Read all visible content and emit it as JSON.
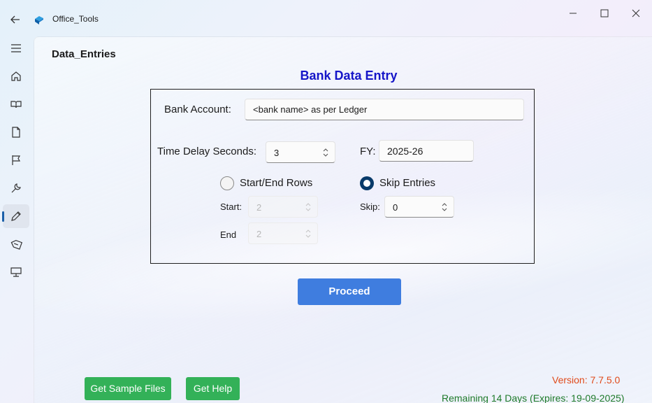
{
  "window": {
    "title": "Office_Tools",
    "icons": [
      "back-arrow-icon",
      "app-logo-icon",
      "minimize-icon",
      "maximize-icon",
      "close-icon"
    ]
  },
  "sidebar": {
    "items": [
      {
        "name": "menu",
        "icon": "hamburger-icon"
      },
      {
        "name": "home",
        "icon": "home-icon"
      },
      {
        "name": "book",
        "icon": "book-icon"
      },
      {
        "name": "document",
        "icon": "document-icon"
      },
      {
        "name": "flag",
        "icon": "flag-icon"
      },
      {
        "name": "tools",
        "icon": "wrench-icon"
      },
      {
        "name": "edit",
        "icon": "pencil-icon",
        "active": true
      },
      {
        "name": "tag",
        "icon": "eraser-icon"
      },
      {
        "name": "desktop",
        "icon": "desktop-icon"
      }
    ]
  },
  "page": {
    "title": "Data_Entries",
    "heading": "Bank Data Entry",
    "heading_color": "#1515c8"
  },
  "form": {
    "bank_account_label": "Bank Account:",
    "bank_account_value": "<bank name> as per Ledger",
    "time_delay_label": "Time Delay Seconds:",
    "time_delay_value": "3",
    "fy_label": "FY:",
    "fy_value": "2025-26",
    "option_start_end": "Start/End Rows",
    "option_skip": "Skip Entries",
    "selected_option": "Skip Entries",
    "start_label": "Start:",
    "start_value": "2",
    "end_label": "End",
    "end_value": "2",
    "skip_label": "Skip:",
    "skip_value": "0"
  },
  "actions": {
    "proceed": "Proceed",
    "get_sample_files": "Get Sample Files",
    "get_help": "Get Help"
  },
  "footer": {
    "version": "Version: 7.7.5.0",
    "remaining": "Remaining 14 Days (Expires: 19-09-2025)"
  },
  "colors": {
    "accent": "#3f7ddf",
    "green": "#33b158",
    "version": "#e04a1a",
    "remaining": "#1e7a2a",
    "radio_selected": "#083a69"
  }
}
